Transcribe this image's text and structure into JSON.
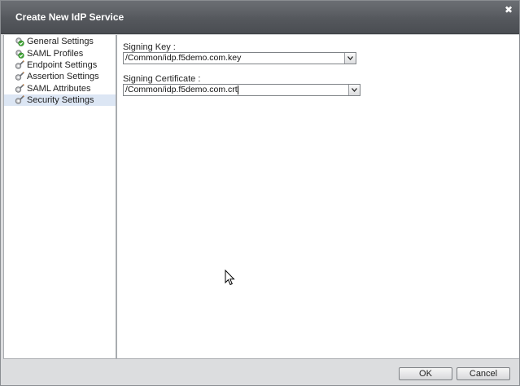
{
  "dialog": {
    "title": "Create New IdP Service",
    "close_icon": "close-icon"
  },
  "sidebar": {
    "items": [
      {
        "label": "General Settings",
        "status": "complete"
      },
      {
        "label": "SAML Profiles",
        "status": "complete"
      },
      {
        "label": "Endpoint Settings",
        "status": "edit"
      },
      {
        "label": "Assertion Settings",
        "status": "edit"
      },
      {
        "label": "SAML Attributes",
        "status": "edit"
      },
      {
        "label": "Security Settings",
        "status": "edit",
        "selected": true
      }
    ]
  },
  "form": {
    "signing_key": {
      "label": "Signing Key :",
      "value": "/Common/idp.f5demo.com.key"
    },
    "signing_certificate": {
      "label": "Signing Certificate :",
      "value": "/Common/idp.f5demo.com.crt"
    }
  },
  "footer": {
    "ok_label": "OK",
    "cancel_label": "Cancel"
  },
  "colors": {
    "titlebar": "#55585d",
    "selected_item": "#dce6f4",
    "complete_check": "#3fa535"
  }
}
